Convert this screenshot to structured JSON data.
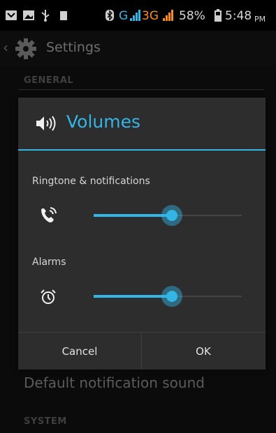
{
  "status_bar": {
    "network_g": "G",
    "network_3g": "3G",
    "battery": "58%",
    "time": "5:48",
    "ampm": "PM"
  },
  "action_bar": {
    "title": "Settings",
    "icon": "gear-icon"
  },
  "background": {
    "general_header": "GENERAL",
    "notification_sound": "Default notification sound",
    "system_header": "SYSTEM"
  },
  "dialog": {
    "title": "Volumes",
    "title_icon": "speaker-icon",
    "accent_color": "#33b5e5",
    "ringtone": {
      "label": "Ringtone & notifications",
      "icon": "ringtone-icon",
      "level": 0.53
    },
    "alarms": {
      "label": "Alarms",
      "icon": "alarm-clock-icon",
      "level": 0.53
    },
    "cancel_label": "Cancel",
    "ok_label": "OK"
  }
}
